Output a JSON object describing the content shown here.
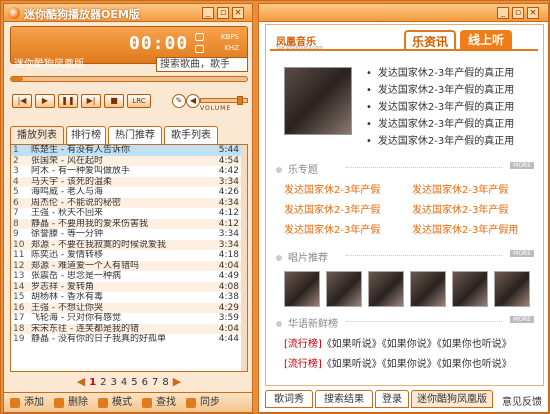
{
  "window": {
    "title": "迷你酷狗播放器OEM版"
  },
  "player": {
    "time": "00:00",
    "kbps_label": "KBPS",
    "khz_label": "KHZ",
    "current_song": "迷你酷狗凤凰版",
    "search_placeholder": "搜索歌曲，歌手",
    "lrc_label": "LRC",
    "volume_label": "VOLUME",
    "progress": 0.05,
    "volume": 0.85
  },
  "tabs": [
    "播放列表",
    "排行榜",
    "热门推荐",
    "歌手列表"
  ],
  "playlist": [
    {
      "n": "1",
      "title": "陈楚生 - 有没有人告诉你",
      "dur": "5:44"
    },
    {
      "n": "2",
      "title": "张国荣 - 风在起时",
      "dur": "4:54"
    },
    {
      "n": "3",
      "title": "阿木 - 有一种爱叫做放手",
      "dur": "4:42"
    },
    {
      "n": "4",
      "title": "马天宇 - 该死的温柔",
      "dur": "3:34"
    },
    {
      "n": "5",
      "title": "海鸣威 - 老人与海",
      "dur": "4:26"
    },
    {
      "n": "6",
      "title": "周杰伦 - 不能说的秘密",
      "dur": "4:34"
    },
    {
      "n": "7",
      "title": "王强 - 秋天不回来",
      "dur": "4:12"
    },
    {
      "n": "8",
      "title": "静晶 - 不要用我的爱来伤害我",
      "dur": "4:12"
    },
    {
      "n": "9",
      "title": "徐誉滕 - 等一分钟",
      "dur": "3:34"
    },
    {
      "n": "10",
      "title": "郑源 - 不要在我寂寞的时候说爱我",
      "dur": "3:34"
    },
    {
      "n": "11",
      "title": "陈奕迅 - 爱情转移",
      "dur": "4:18"
    },
    {
      "n": "12",
      "title": "郑源 - 难道爱一个人有错吗",
      "dur": "4:04"
    },
    {
      "n": "13",
      "title": "张震岳 - 思念是一种病",
      "dur": "4:49"
    },
    {
      "n": "14",
      "title": "罗志祥 - 爱转角",
      "dur": "4:08"
    },
    {
      "n": "15",
      "title": "胡杨林 - 香水有毒",
      "dur": "4:38"
    },
    {
      "n": "16",
      "title": "王强 - 不想让你哭",
      "dur": "4:29"
    },
    {
      "n": "17",
      "title": "飞轮海 - 只对你有感觉",
      "dur": "3:59"
    },
    {
      "n": "18",
      "title": "宋宋东往 - 连笑都是我的错",
      "dur": "4:04"
    },
    {
      "n": "19",
      "title": "静晶 - 没有你的日子我真的好孤单",
      "dur": "4:44"
    }
  ],
  "pager": {
    "pages": [
      "1",
      "2",
      "3",
      "4",
      "5",
      "6",
      "7",
      "8"
    ],
    "current": "1"
  },
  "bottom_actions": [
    {
      "label": "添加",
      "icon": "add-icon"
    },
    {
      "label": "删除",
      "icon": "delete-icon"
    },
    {
      "label": "模式",
      "icon": "mode-icon"
    },
    {
      "label": "查找",
      "icon": "find-icon"
    },
    {
      "label": "同步",
      "icon": "sync-icon"
    }
  ],
  "web": {
    "brand": "凤凰音乐",
    "brand_sub": "Yue.phoenixtv.com",
    "tab_news": "乐资讯",
    "tab_online": "线上听",
    "news": [
      "发达国家休2-3年产假的真正用",
      "发达国家休2-3年产假的真正用",
      "发达国家休2-3年产假的真正用",
      "发达国家休2-3年产假的真正用",
      "发达国家休2-3年产假的真正用"
    ],
    "section_topic": "乐专题",
    "section_album": "唱片推荐",
    "section_new": "华语新鲜榜",
    "more": "MORE",
    "topics": [
      "发达国家休2-3年产假",
      "发达国家休2-3年产假",
      "发达国家休2-3年产假",
      "发达国家休2-3年产假",
      "发达国家休2-3年产假",
      "发达国家休2-3年产假用"
    ],
    "charts": [
      {
        "tag": "[流行榜]",
        "items": "《如果听说》《如果你说》《如果你也听说》"
      },
      {
        "tag": "[流行榜]",
        "items": "《如果听说》《如果你说》《如果你也听说》"
      }
    ],
    "bottom_tabs": [
      "歌词秀",
      "搜索结果",
      "登录",
      "迷你酷狗凤凰版"
    ],
    "feedback": "意见反馈"
  },
  "colors": {
    "accent": "#e07a1c",
    "link_orange": "#e86a0a",
    "chart_red": "#c40000"
  }
}
